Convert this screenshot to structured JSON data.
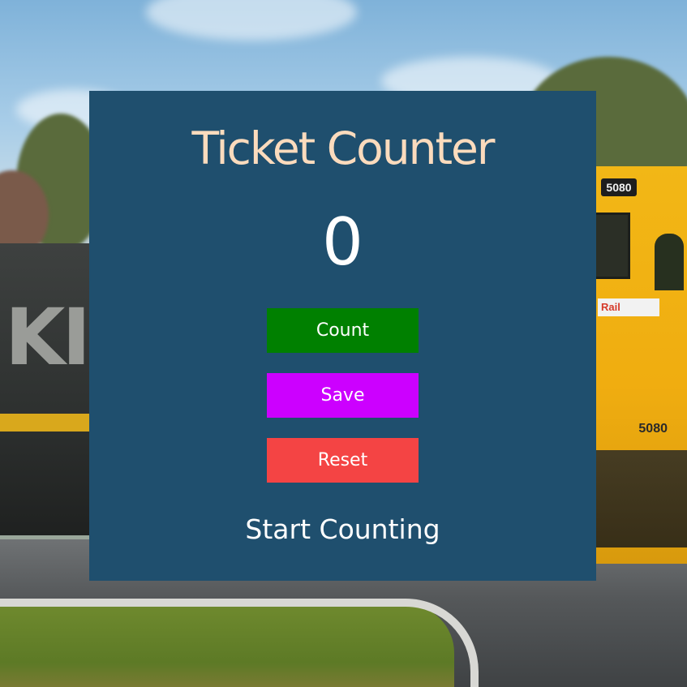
{
  "app": {
    "title": "Ticket Counter",
    "count_value": "0",
    "status_text": "Start Counting"
  },
  "buttons": {
    "count_label": "Count",
    "save_label": "Save",
    "reset_label": "Reset"
  },
  "background": {
    "left_train_text": "KIW",
    "right_train_plate": "5080",
    "right_train_rail_logo": "Rail",
    "right_train_number": "5080"
  },
  "colors": {
    "panel": "#1f4f6e",
    "title": "#fbdbbd",
    "count_button": "#008000",
    "save_button": "#cc00ff",
    "reset_button": "#f44444"
  }
}
